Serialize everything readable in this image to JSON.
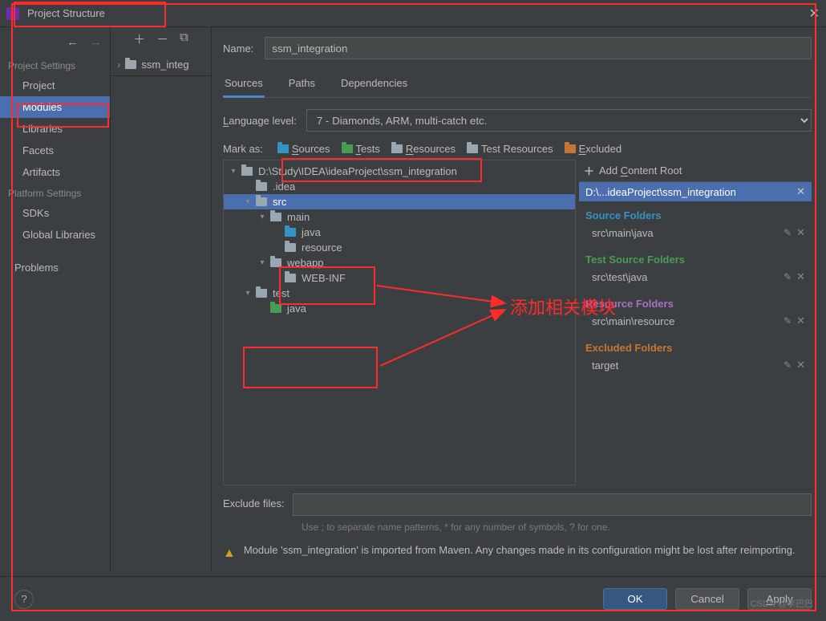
{
  "window": {
    "title": "Project Structure"
  },
  "sidebar": {
    "sections": [
      {
        "heading": "Project Settings",
        "items": [
          "Project",
          "Modules",
          "Libraries",
          "Facets",
          "Artifacts"
        ],
        "selected": 1
      },
      {
        "heading": "Platform Settings",
        "items": [
          "SDKs",
          "Global Libraries"
        ]
      },
      {
        "heading": "",
        "items": [
          "Problems"
        ]
      }
    ]
  },
  "moduleList": {
    "rootLabel": "ssm_integ"
  },
  "form": {
    "nameLabel": "Name:",
    "nameValue": "ssm_integration",
    "tabs": [
      "Sources",
      "Paths",
      "Dependencies"
    ],
    "activeTab": 0,
    "langLabel": "Language level:",
    "langValue": "7 - Diamonds, ARM, multi-catch etc.",
    "markLabel": "Mark as:",
    "marks": {
      "sources": "Sources",
      "tests": "Tests",
      "resources": "Resources",
      "testResources": "Test Resources",
      "excluded": "Excluded"
    },
    "excludeLabel": "Exclude files:",
    "excludeHint": "Use ; to separate name patterns, * for any number of symbols, ? for one.",
    "warning": "Module 'ssm_integration' is imported from Maven. Any changes made in its configuration might be lost after reimporting."
  },
  "tree": [
    {
      "d": 0,
      "exp": "open",
      "color": "grey",
      "label": "D:\\Study\\IDEA\\ideaProject\\ssm_integration"
    },
    {
      "d": 1,
      "exp": "",
      "color": "grey",
      "label": ".idea"
    },
    {
      "d": 1,
      "exp": "open",
      "color": "grey",
      "label": "src",
      "sel": true
    },
    {
      "d": 2,
      "exp": "open",
      "color": "grey",
      "label": "main"
    },
    {
      "d": 3,
      "exp": "",
      "color": "blue",
      "label": "java"
    },
    {
      "d": 3,
      "exp": "",
      "color": "res",
      "label": "resource"
    },
    {
      "d": 2,
      "exp": "open",
      "color": "grey",
      "label": "webapp"
    },
    {
      "d": 3,
      "exp": "",
      "color": "grey",
      "label": "WEB-INF"
    },
    {
      "d": 1,
      "exp": "open",
      "color": "grey",
      "label": "test"
    },
    {
      "d": 2,
      "exp": "",
      "color": "green",
      "label": "java"
    }
  ],
  "rightPane": {
    "addRoot": "Add Content Root",
    "rootPath": "D:\\...ideaProject\\ssm_integration",
    "sections": [
      {
        "title": "Source Folders",
        "cls": "blue",
        "items": [
          "src\\main\\java"
        ]
      },
      {
        "title": "Test Source Folders",
        "cls": "green",
        "items": [
          "src\\test\\java"
        ]
      },
      {
        "title": "Resource Folders",
        "cls": "purple",
        "items": [
          "src\\main\\resource"
        ]
      },
      {
        "title": "Excluded Folders",
        "cls": "orange",
        "items": [
          "target"
        ]
      }
    ]
  },
  "footer": {
    "ok": "OK",
    "cancel": "Cancel",
    "apply": "Apply"
  },
  "annotation": {
    "text": "添加相关模块"
  },
  "watermark": "CSDN @李巴巴"
}
